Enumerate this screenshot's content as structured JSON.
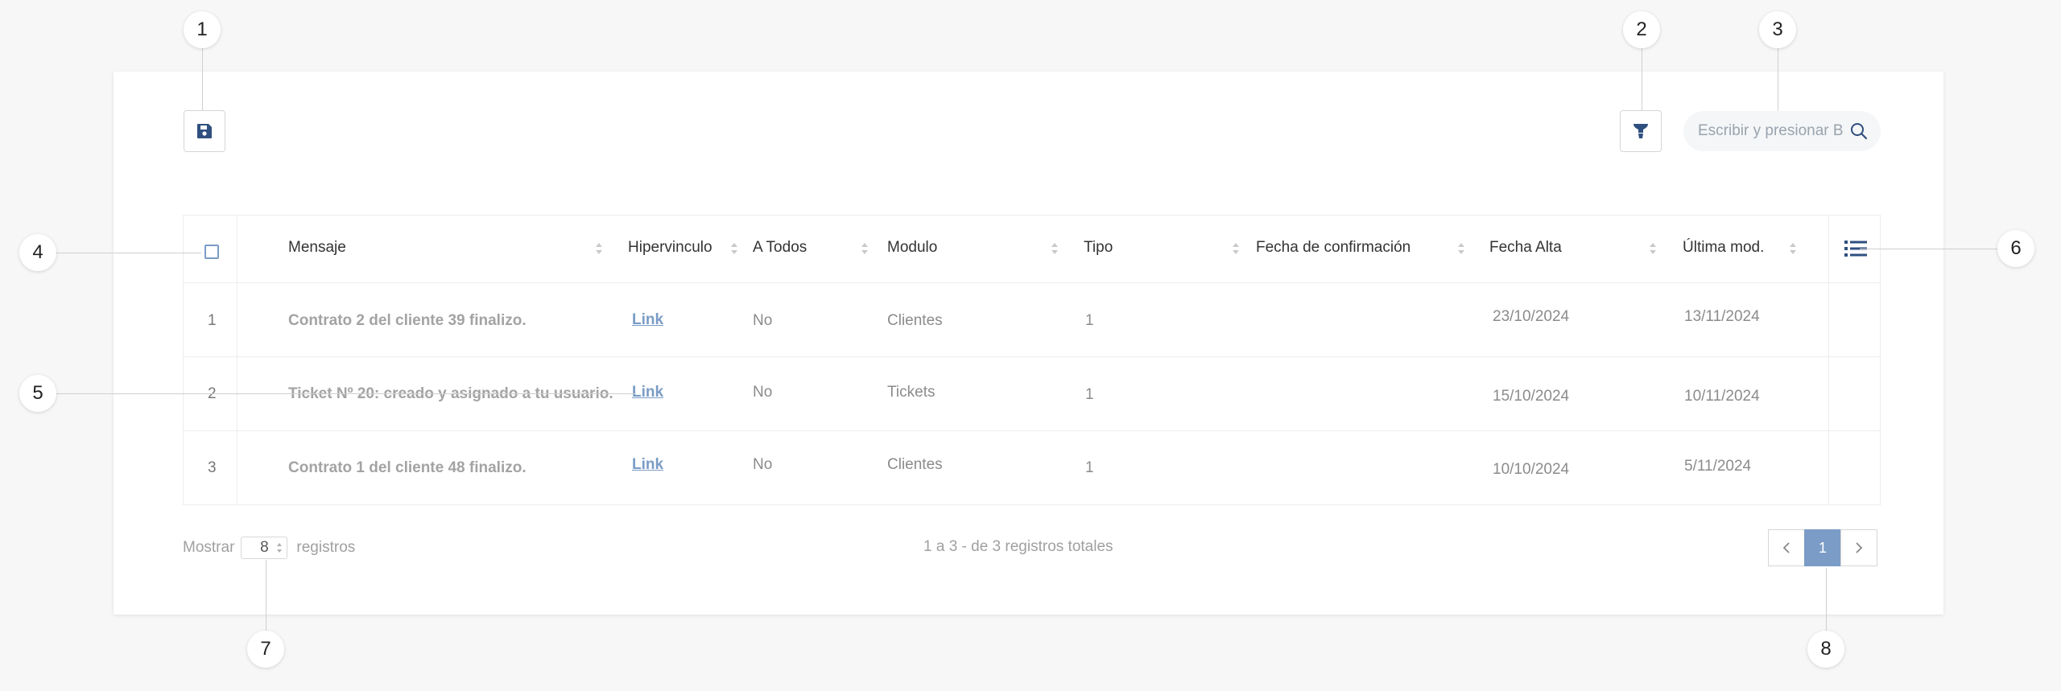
{
  "search": {
    "placeholder": "Escribir y presionar B"
  },
  "table": {
    "headers": {
      "mensaje": "Mensaje",
      "hipervinculo": "Hipervinculo",
      "a_todos": "A Todos",
      "modulo": "Modulo",
      "tipo": "Tipo",
      "fecha_confirmacion": "Fecha de confirmación",
      "fecha_alta": "Fecha Alta",
      "ultima_mod": "Última mod."
    },
    "rows": [
      {
        "idx": "1",
        "mensaje": "Contrato 2 del cliente 39 finalizo.",
        "link": "Link",
        "a_todos": "No",
        "modulo": "Clientes",
        "tipo": "1",
        "fecha_confirmacion": "",
        "fecha_alta": "23/10/2024",
        "ultima_mod": "13/11/2024"
      },
      {
        "idx": "2",
        "mensaje": "Ticket Nº 20: creado y asignado a tu usuario.",
        "link": "Link",
        "a_todos": "No",
        "modulo": "Tickets",
        "tipo": "1",
        "fecha_confirmacion": "",
        "fecha_alta": "15/10/2024",
        "ultima_mod": "10/11/2024"
      },
      {
        "idx": "3",
        "mensaje": "Contrato 1 del cliente 48 finalizo.",
        "link": "Link",
        "a_todos": "No",
        "modulo": "Clientes",
        "tipo": "1",
        "fecha_confirmacion": "",
        "fecha_alta": "10/10/2024",
        "ultima_mod": "5/11/2024"
      }
    ]
  },
  "footer": {
    "show_label": "Mostrar",
    "page_size": "8",
    "records_label": "registros",
    "summary": "1 a 3 - de 3 registros totales",
    "current_page": "1"
  },
  "markers": [
    "1",
    "2",
    "3",
    "4",
    "5",
    "6",
    "7",
    "8"
  ],
  "colors": {
    "accent": "#7a9cc6",
    "icon": "#2f4f7f"
  },
  "icons": [
    "save-icon",
    "filter-icon",
    "search-icon",
    "column-list-icon",
    "chevron-left-icon",
    "chevron-right-icon",
    "sort-icon"
  ]
}
